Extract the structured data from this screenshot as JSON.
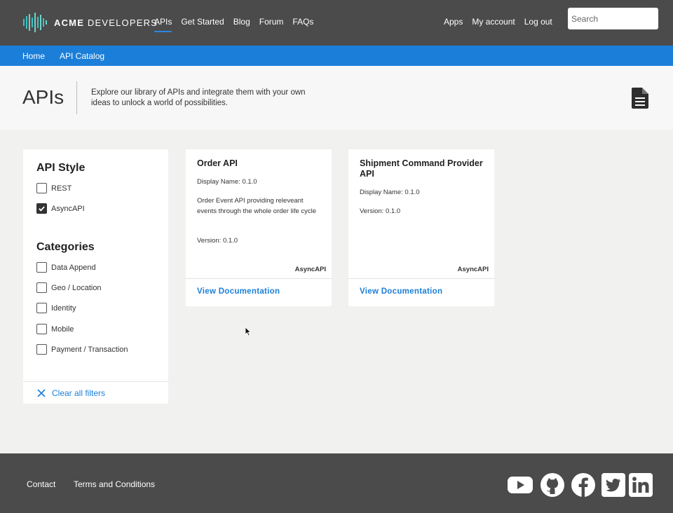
{
  "header": {
    "logo_strong": "ACME",
    "logo_rest": " DEVELOPERS",
    "nav": [
      "APIs",
      "Get Started",
      "Blog",
      "Forum",
      "FAQs"
    ],
    "user_nav": [
      "Apps",
      "My account",
      "Log out"
    ],
    "search_placeholder": "Search"
  },
  "breadcrumb": [
    "Home",
    "API Catalog"
  ],
  "hero": {
    "title": "APIs",
    "description": "Explore our library of APIs and integrate them with your own ideas to unlock a world of possibilities."
  },
  "filters": {
    "style_title": "API Style",
    "styles": [
      {
        "label": "REST",
        "checked": false
      },
      {
        "label": "AsyncAPI",
        "checked": true
      }
    ],
    "categories_title": "Categories",
    "categories": [
      "Data Append",
      "Geo / Location",
      "Identity",
      "Mobile",
      "Payment / Transaction"
    ],
    "clear_label": "Clear all filters"
  },
  "cards": [
    {
      "title": "Order API",
      "display_name": "Display Name: 0.1.0",
      "description": "Order Event API providing releveant events through the whole order life cycle",
      "version": "Version: 0.1.0",
      "tag": "AsyncAPI",
      "link": "View Documentation"
    },
    {
      "title": "Shipment Command Provider API",
      "display_name": "Display Name: 0.1.0",
      "description": "",
      "version": "Version: 0.1.0",
      "tag": "AsyncAPI",
      "link": "View Documentation"
    }
  ],
  "footer": {
    "links": [
      "Contact",
      "Terms and Conditions"
    ],
    "social": [
      "youtube-icon",
      "github-icon",
      "facebook-icon",
      "twitter-icon",
      "linkedin-icon"
    ]
  },
  "colors": {
    "header": "#4b4b4b",
    "accent": "#1b7fd9",
    "logo_teal": "#3ec1c9"
  }
}
